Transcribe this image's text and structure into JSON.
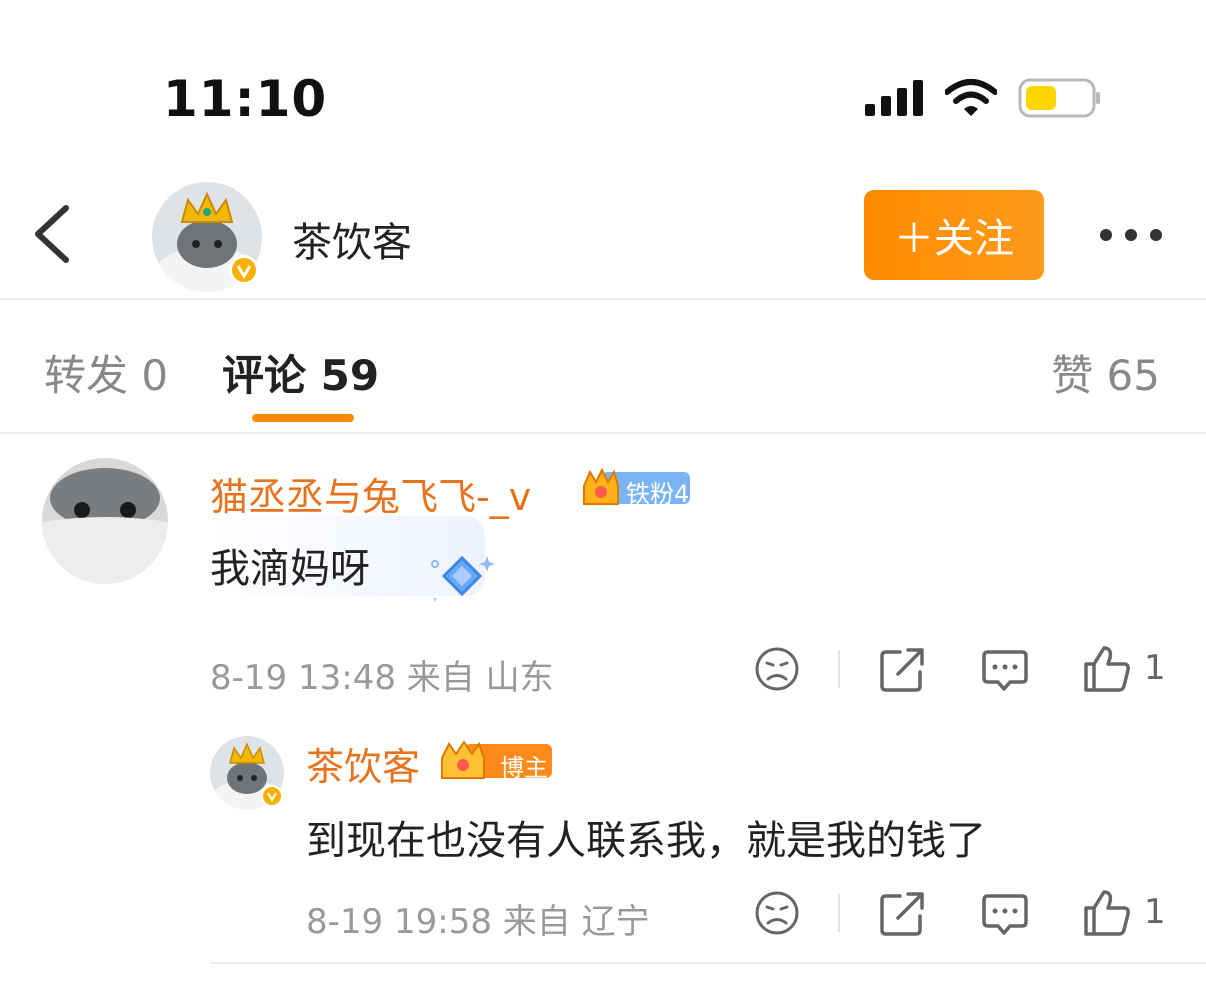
{
  "status_bar": {
    "time": "11:10",
    "battery_color": "#FFD500"
  },
  "header": {
    "name": "茶饮客",
    "follow_label": "＋关注",
    "accent": "#FF8A00"
  },
  "tabs": {
    "repost": "转发 0",
    "comments": "评论 59",
    "likes": "赞 65"
  },
  "comment": {
    "username": "猫丞丞与兔飞飞-_v",
    "fan_badge": "铁粉4",
    "text": "我滴妈呀",
    "time": "8-19 13:48",
    "location": "来自 山东",
    "like_count": "1"
  },
  "reply": {
    "username": "茶饮客",
    "badge": "博主",
    "text": "到现在也没有人联系我，就是我的钱了",
    "time": "8-19 19:58",
    "location": "来自 辽宁",
    "like_count": "1"
  },
  "icons": [
    "signal-icon",
    "wifi-icon",
    "battery-icon",
    "back-icon",
    "verified-icon",
    "more-icon",
    "crown-icon",
    "diamond-icon",
    "dislike-icon",
    "share-icon",
    "comment-icon",
    "like-icon"
  ]
}
